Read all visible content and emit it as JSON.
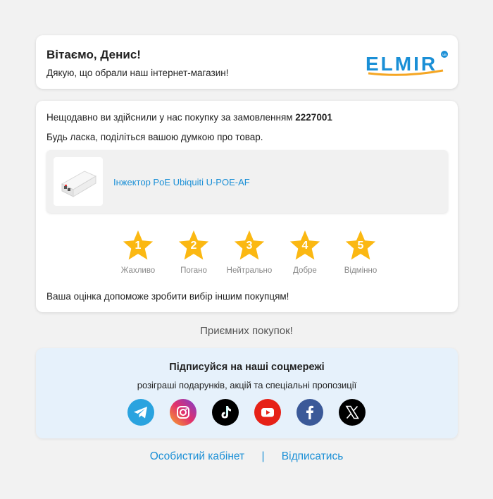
{
  "greeting": {
    "title": "Вітаємо, Денис!",
    "subtitle": "Дякую, що обрали наш інтернет-магазин!",
    "logo_text": "ELMIR",
    "logo_badge": "ua"
  },
  "order": {
    "intro": "Нещодавно ви здійснили у нас покупку за замовленням ",
    "number": "2227001",
    "request": "Будь ласка, поділіться вашою думкою про товар.",
    "product_name": "Інжектор PoE Ubiquiti U-POE-AF",
    "rating_options": [
      {
        "num": "1",
        "label": "Жахливо"
      },
      {
        "num": "2",
        "label": "Погано"
      },
      {
        "num": "3",
        "label": "Нейтрально"
      },
      {
        "num": "4",
        "label": "Добре"
      },
      {
        "num": "5",
        "label": "Відмінно"
      }
    ],
    "footer_note": "Ваша оцінка допоможе зробити вибір іншим покупцям!"
  },
  "thanks": "Приємних покупок!",
  "social": {
    "title": "Підписуйся на наші соцмережі",
    "subtitle": "розіграші подарунків, акцій та спеціальні пропозиції",
    "networks": [
      "telegram-icon",
      "instagram-icon",
      "tiktok-icon",
      "youtube-icon",
      "facebook-icon",
      "x-icon"
    ]
  },
  "footer": {
    "account_link": "Особистий кабінет",
    "separator": "|",
    "unsubscribe_link": "Відписатись"
  },
  "colors": {
    "background": "#f2f2f2",
    "link": "#1a8fd6",
    "star": "#fbb812",
    "social_bg": "#e6f1fb",
    "logo": "#1a8fd6"
  }
}
